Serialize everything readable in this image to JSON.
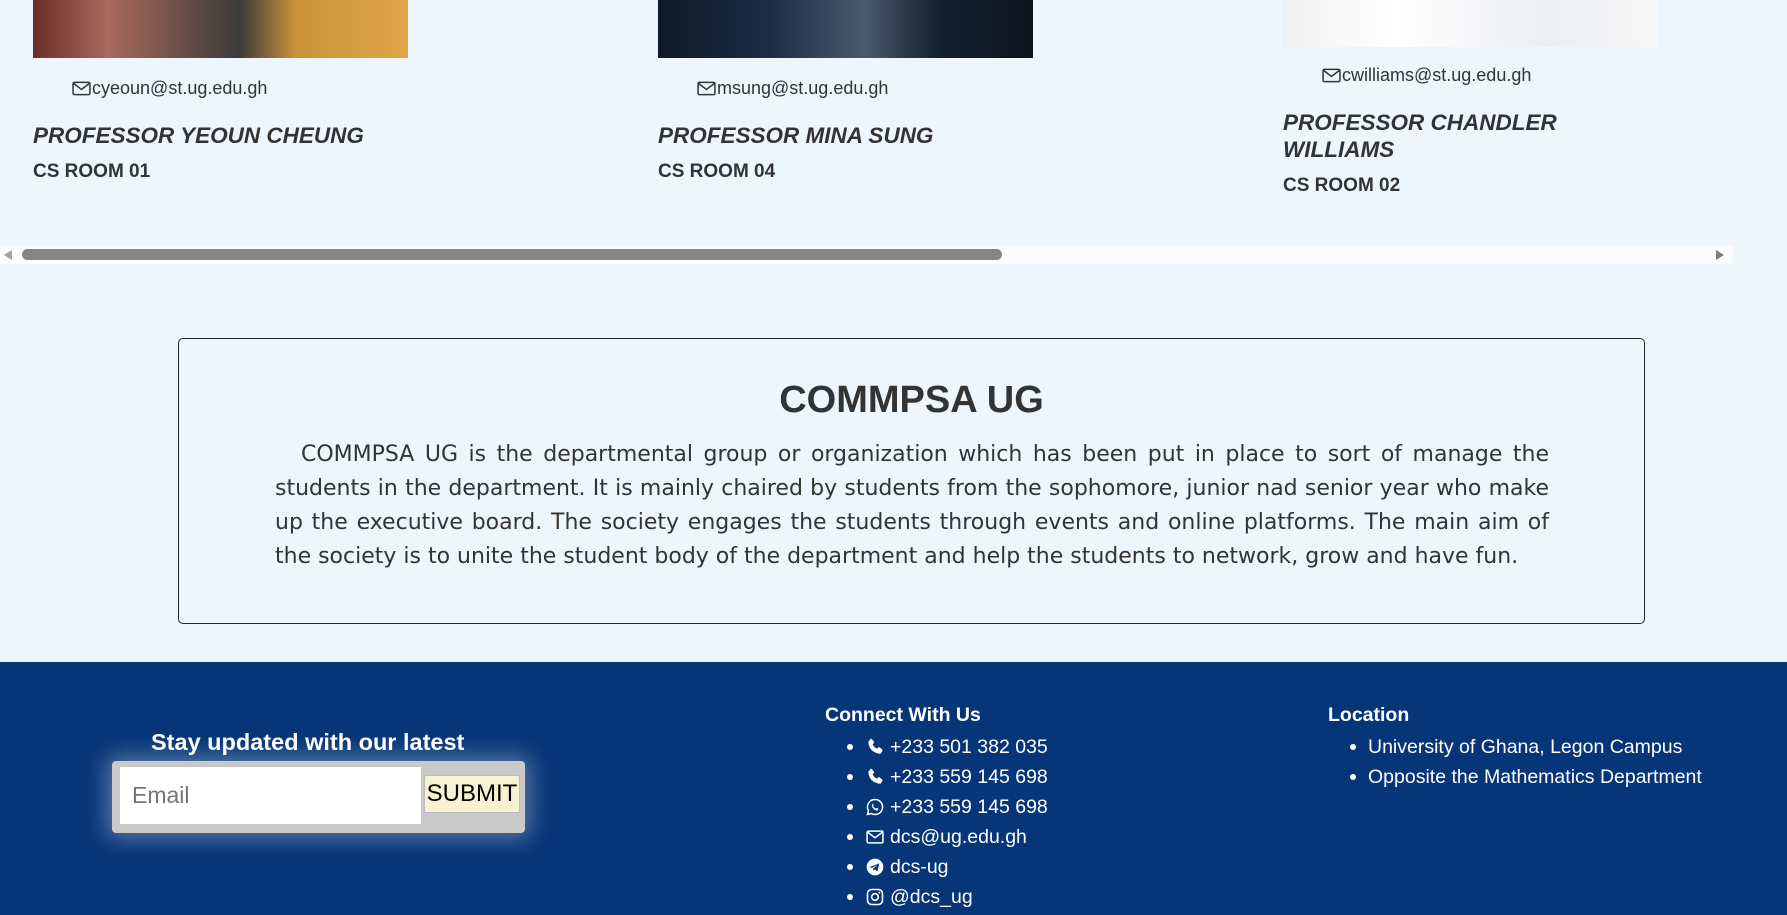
{
  "professors": [
    {
      "email": "cyeoun@st.ug.edu.gh",
      "name": "PROFESSOR YEOUN CHEUNG",
      "room": "CS ROOM 01"
    },
    {
      "email": "msung@st.ug.edu.gh",
      "name": "PROFESSOR MINA SUNG",
      "room": "CS ROOM 04"
    },
    {
      "email": "cwilliams@st.ug.edu.gh",
      "name": "PROFESSOR CHANDLER WILLIAMS",
      "room": "CS ROOM 02"
    }
  ],
  "scroll": {
    "position_fraction": 0.58
  },
  "commpsa": {
    "title": "COMMPSA UG",
    "body": "COMMPSA UG is the departmental group or organization which has been put in place to sort of manage the students in the department. It is mainly chaired by students from the sophomore, junior nad senior year who make up the executive board. The society engages the students through events and online platforms. The main aim of the society is to unite the student body of the department and help the students to network, grow and have fun."
  },
  "footer": {
    "subscribe": {
      "title": "Stay updated with our latest",
      "email_placeholder": "Email",
      "submit_label": "SUBMIT"
    },
    "connect": {
      "heading": "Connect With Us",
      "items": [
        {
          "icon": "phone-icon",
          "text": "+233 501 382 035"
        },
        {
          "icon": "phone-icon",
          "text": "+233 559 145 698"
        },
        {
          "icon": "whatsapp-icon",
          "text": "+233 559 145 698"
        },
        {
          "icon": "envelope-icon",
          "text": "dcs@ug.edu.gh"
        },
        {
          "icon": "telegram-icon",
          "text": "dcs-ug"
        },
        {
          "icon": "instagram-icon",
          "text": "@dcs_ug"
        }
      ]
    },
    "location": {
      "heading": "Location",
      "items": [
        "University of Ghana, Legon Campus",
        "Opposite the Mathematics Department"
      ]
    },
    "colors": {
      "background": "#063578",
      "text": "#ffffff"
    }
  }
}
